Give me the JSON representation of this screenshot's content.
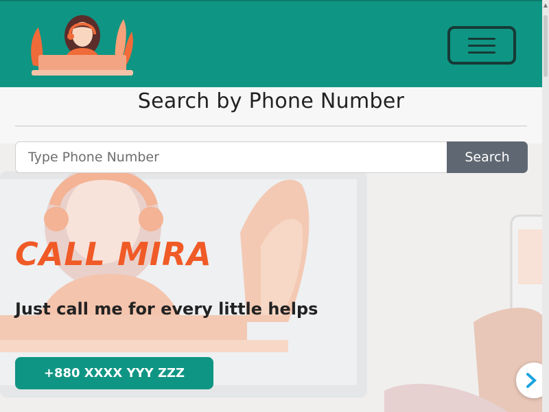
{
  "header": {
    "logo_alt": "Call Mira logo",
    "menu_button_label": "Toggle navigation"
  },
  "search": {
    "title": "Search by Phone Number",
    "input_value": "",
    "placeholder": "Type Phone Number",
    "button_label": "Search"
  },
  "hero": {
    "title": "CALL MIRA",
    "subtitle": "Just call me for every little helps",
    "phone_button_label": "+880 XXXX YYY ZZZ"
  },
  "colors": {
    "brand": "#0f9584",
    "accent": "#f05a26",
    "button_gray": "#5f6872"
  },
  "icons": {
    "menu": "hamburger-icon",
    "chat": "chevron-right-icon"
  }
}
